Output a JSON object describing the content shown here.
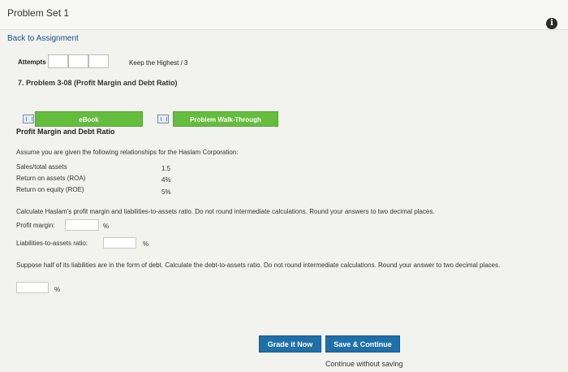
{
  "header": {
    "title": "Problem Set 1",
    "info_icon": "i"
  },
  "nav": {
    "back": "Back to Assignment"
  },
  "attempts": {
    "label": "Attempts",
    "keep": "Keep the Highest / 3"
  },
  "problem": {
    "title": "7. Problem 3-08 (Profit Margin and Debt Ratio)"
  },
  "buttons": {
    "ebook": "eBook",
    "walkthrough": "Problem Walk-Through"
  },
  "content": {
    "section_title": "Profit Margin and Debt Ratio",
    "intro": "Assume you are given the following relationships for the Haslam Corporation:",
    "rows": [
      {
        "label": "Sales/total assets",
        "value": "1.5"
      },
      {
        "label": "Return on assets (ROA)",
        "value": "4%"
      },
      {
        "label": "Return on equity (ROE)",
        "value": "5%"
      }
    ],
    "question1": "Calculate Haslam's profit margin and liabilities-to-assets ratio. Do not round intermediate calculations. Round your answers to two decimal places.",
    "profit_label": "Profit margin:",
    "profit_unit": "%",
    "liab_label": "Liabilities-to-assets ratio:",
    "liab_unit": "%",
    "question2": "Suppose half of its liabilities are in the form of debt. Calculate the debt-to-assets ratio. Do not round intermediate calculations. Round your answer to two decimal places.",
    "debt_unit": "%"
  },
  "actions": {
    "grade": "Grade it Now",
    "save": "Save & Continue",
    "continue": "Continue without saving"
  }
}
